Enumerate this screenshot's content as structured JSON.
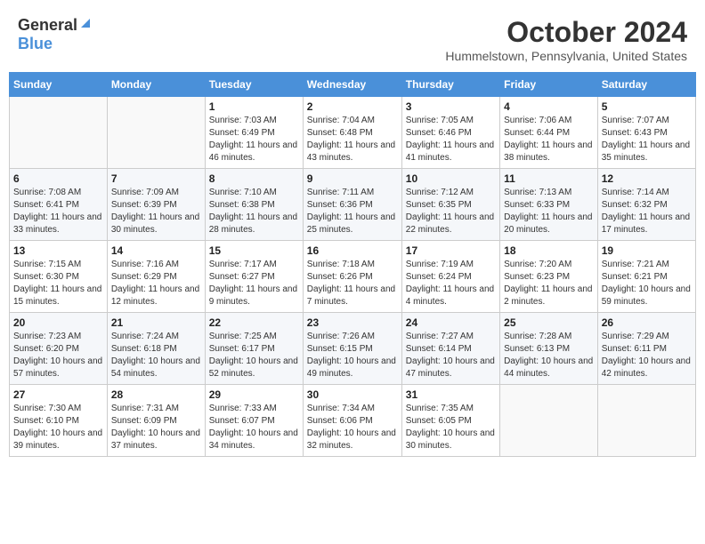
{
  "header": {
    "logo_general": "General",
    "logo_blue": "Blue",
    "month": "October 2024",
    "location": "Hummelstown, Pennsylvania, United States"
  },
  "weekdays": [
    "Sunday",
    "Monday",
    "Tuesday",
    "Wednesday",
    "Thursday",
    "Friday",
    "Saturday"
  ],
  "weeks": [
    [
      {
        "day": "",
        "sunrise": "",
        "sunset": "",
        "daylight": ""
      },
      {
        "day": "",
        "sunrise": "",
        "sunset": "",
        "daylight": ""
      },
      {
        "day": "1",
        "sunrise": "Sunrise: 7:03 AM",
        "sunset": "Sunset: 6:49 PM",
        "daylight": "Daylight: 11 hours and 46 minutes."
      },
      {
        "day": "2",
        "sunrise": "Sunrise: 7:04 AM",
        "sunset": "Sunset: 6:48 PM",
        "daylight": "Daylight: 11 hours and 43 minutes."
      },
      {
        "day": "3",
        "sunrise": "Sunrise: 7:05 AM",
        "sunset": "Sunset: 6:46 PM",
        "daylight": "Daylight: 11 hours and 41 minutes."
      },
      {
        "day": "4",
        "sunrise": "Sunrise: 7:06 AM",
        "sunset": "Sunset: 6:44 PM",
        "daylight": "Daylight: 11 hours and 38 minutes."
      },
      {
        "day": "5",
        "sunrise": "Sunrise: 7:07 AM",
        "sunset": "Sunset: 6:43 PM",
        "daylight": "Daylight: 11 hours and 35 minutes."
      }
    ],
    [
      {
        "day": "6",
        "sunrise": "Sunrise: 7:08 AM",
        "sunset": "Sunset: 6:41 PM",
        "daylight": "Daylight: 11 hours and 33 minutes."
      },
      {
        "day": "7",
        "sunrise": "Sunrise: 7:09 AM",
        "sunset": "Sunset: 6:39 PM",
        "daylight": "Daylight: 11 hours and 30 minutes."
      },
      {
        "day": "8",
        "sunrise": "Sunrise: 7:10 AM",
        "sunset": "Sunset: 6:38 PM",
        "daylight": "Daylight: 11 hours and 28 minutes."
      },
      {
        "day": "9",
        "sunrise": "Sunrise: 7:11 AM",
        "sunset": "Sunset: 6:36 PM",
        "daylight": "Daylight: 11 hours and 25 minutes."
      },
      {
        "day": "10",
        "sunrise": "Sunrise: 7:12 AM",
        "sunset": "Sunset: 6:35 PM",
        "daylight": "Daylight: 11 hours and 22 minutes."
      },
      {
        "day": "11",
        "sunrise": "Sunrise: 7:13 AM",
        "sunset": "Sunset: 6:33 PM",
        "daylight": "Daylight: 11 hours and 20 minutes."
      },
      {
        "day": "12",
        "sunrise": "Sunrise: 7:14 AM",
        "sunset": "Sunset: 6:32 PM",
        "daylight": "Daylight: 11 hours and 17 minutes."
      }
    ],
    [
      {
        "day": "13",
        "sunrise": "Sunrise: 7:15 AM",
        "sunset": "Sunset: 6:30 PM",
        "daylight": "Daylight: 11 hours and 15 minutes."
      },
      {
        "day": "14",
        "sunrise": "Sunrise: 7:16 AM",
        "sunset": "Sunset: 6:29 PM",
        "daylight": "Daylight: 11 hours and 12 minutes."
      },
      {
        "day": "15",
        "sunrise": "Sunrise: 7:17 AM",
        "sunset": "Sunset: 6:27 PM",
        "daylight": "Daylight: 11 hours and 9 minutes."
      },
      {
        "day": "16",
        "sunrise": "Sunrise: 7:18 AM",
        "sunset": "Sunset: 6:26 PM",
        "daylight": "Daylight: 11 hours and 7 minutes."
      },
      {
        "day": "17",
        "sunrise": "Sunrise: 7:19 AM",
        "sunset": "Sunset: 6:24 PM",
        "daylight": "Daylight: 11 hours and 4 minutes."
      },
      {
        "day": "18",
        "sunrise": "Sunrise: 7:20 AM",
        "sunset": "Sunset: 6:23 PM",
        "daylight": "Daylight: 11 hours and 2 minutes."
      },
      {
        "day": "19",
        "sunrise": "Sunrise: 7:21 AM",
        "sunset": "Sunset: 6:21 PM",
        "daylight": "Daylight: 10 hours and 59 minutes."
      }
    ],
    [
      {
        "day": "20",
        "sunrise": "Sunrise: 7:23 AM",
        "sunset": "Sunset: 6:20 PM",
        "daylight": "Daylight: 10 hours and 57 minutes."
      },
      {
        "day": "21",
        "sunrise": "Sunrise: 7:24 AM",
        "sunset": "Sunset: 6:18 PM",
        "daylight": "Daylight: 10 hours and 54 minutes."
      },
      {
        "day": "22",
        "sunrise": "Sunrise: 7:25 AM",
        "sunset": "Sunset: 6:17 PM",
        "daylight": "Daylight: 10 hours and 52 minutes."
      },
      {
        "day": "23",
        "sunrise": "Sunrise: 7:26 AM",
        "sunset": "Sunset: 6:15 PM",
        "daylight": "Daylight: 10 hours and 49 minutes."
      },
      {
        "day": "24",
        "sunrise": "Sunrise: 7:27 AM",
        "sunset": "Sunset: 6:14 PM",
        "daylight": "Daylight: 10 hours and 47 minutes."
      },
      {
        "day": "25",
        "sunrise": "Sunrise: 7:28 AM",
        "sunset": "Sunset: 6:13 PM",
        "daylight": "Daylight: 10 hours and 44 minutes."
      },
      {
        "day": "26",
        "sunrise": "Sunrise: 7:29 AM",
        "sunset": "Sunset: 6:11 PM",
        "daylight": "Daylight: 10 hours and 42 minutes."
      }
    ],
    [
      {
        "day": "27",
        "sunrise": "Sunrise: 7:30 AM",
        "sunset": "Sunset: 6:10 PM",
        "daylight": "Daylight: 10 hours and 39 minutes."
      },
      {
        "day": "28",
        "sunrise": "Sunrise: 7:31 AM",
        "sunset": "Sunset: 6:09 PM",
        "daylight": "Daylight: 10 hours and 37 minutes."
      },
      {
        "day": "29",
        "sunrise": "Sunrise: 7:33 AM",
        "sunset": "Sunset: 6:07 PM",
        "daylight": "Daylight: 10 hours and 34 minutes."
      },
      {
        "day": "30",
        "sunrise": "Sunrise: 7:34 AM",
        "sunset": "Sunset: 6:06 PM",
        "daylight": "Daylight: 10 hours and 32 minutes."
      },
      {
        "day": "31",
        "sunrise": "Sunrise: 7:35 AM",
        "sunset": "Sunset: 6:05 PM",
        "daylight": "Daylight: 10 hours and 30 minutes."
      },
      {
        "day": "",
        "sunrise": "",
        "sunset": "",
        "daylight": ""
      },
      {
        "day": "",
        "sunrise": "",
        "sunset": "",
        "daylight": ""
      }
    ]
  ]
}
